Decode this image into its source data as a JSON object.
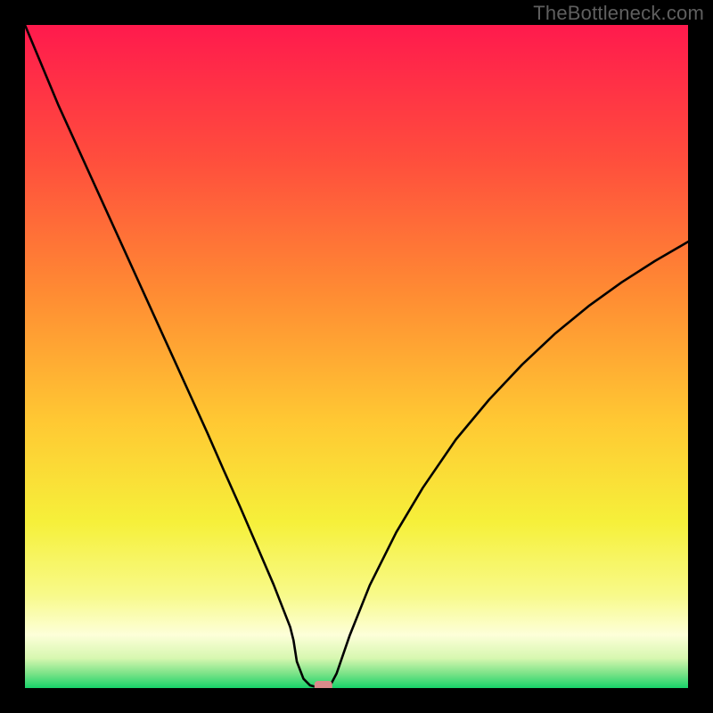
{
  "watermark": "TheBottleneck.com",
  "chart_data": {
    "type": "line",
    "title": "",
    "xlabel": "",
    "ylabel": "",
    "xlim": [
      0,
      100
    ],
    "ylim": [
      0,
      100
    ],
    "x": [
      0,
      2.5,
      5,
      7.5,
      10,
      12.5,
      15,
      17.5,
      20,
      22.5,
      25,
      27.5,
      30,
      32.5,
      35,
      37.5,
      40,
      40.5,
      41,
      42,
      43,
      44.5,
      45.5,
      46,
      47,
      49,
      52,
      56,
      60,
      65,
      70,
      75,
      80,
      85,
      90,
      95,
      100
    ],
    "values": [
      100,
      94,
      88,
      82.5,
      77,
      71.5,
      66,
      60.5,
      55,
      49.5,
      44,
      38.5,
      32.8,
      27.2,
      21.4,
      15.6,
      9.2,
      7.2,
      4,
      1.4,
      0.4,
      0,
      0,
      0.3,
      2.2,
      8,
      15.5,
      23.5,
      30.2,
      37.5,
      43.5,
      48.8,
      53.5,
      57.6,
      61.2,
      64.4,
      67.3
    ],
    "marker": {
      "x": 45,
      "y": 0,
      "color": "#d98a8a"
    },
    "background_gradient": {
      "stops": [
        {
          "offset": 0.0,
          "color": "#ff1a4d"
        },
        {
          "offset": 0.2,
          "color": "#ff4d3d"
        },
        {
          "offset": 0.4,
          "color": "#ff8a33"
        },
        {
          "offset": 0.6,
          "color": "#ffc933"
        },
        {
          "offset": 0.75,
          "color": "#f6f03a"
        },
        {
          "offset": 0.86,
          "color": "#f8fa8a"
        },
        {
          "offset": 0.92,
          "color": "#fdffd9"
        },
        {
          "offset": 0.955,
          "color": "#d7f7b0"
        },
        {
          "offset": 0.978,
          "color": "#7ce388"
        },
        {
          "offset": 1.0,
          "color": "#18d36a"
        }
      ]
    }
  }
}
